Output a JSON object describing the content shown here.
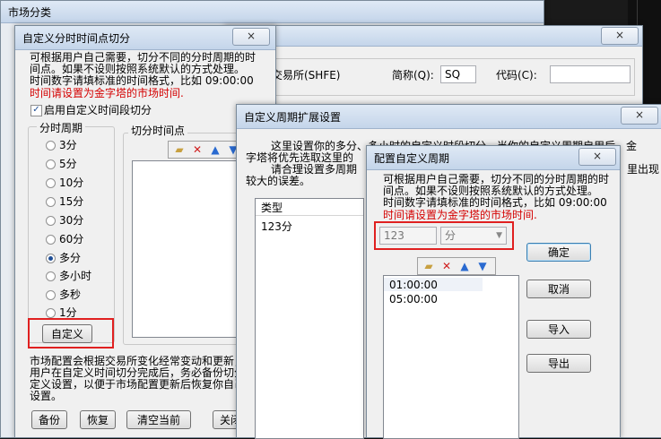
{
  "market_window": {
    "title": "市场分类"
  },
  "market_form": {
    "exchange_text": "交易所(SHFE)",
    "short_label": "简称(Q):",
    "short_value": "SQ",
    "code_label": "代码(C):",
    "code_value": ""
  },
  "split_dialog": {
    "title": "自定义分时时间点切分",
    "close": "×",
    "desc_lines": [
      "可根据用户自己需要，切分不同的分时周期的时",
      "间点。如果不设则按照系统默认的方式处理。",
      "时间数字请填标准的时间格式，比如 09:00:00"
    ],
    "warn": "时间请设置为金字塔的市场时间.",
    "enable_label": "启用自定义时间段切分",
    "enable_checked": "✓",
    "period_group": "分时周期",
    "periods": [
      "3分",
      "5分",
      "10分",
      "15分",
      "30分",
      "60分",
      "多分",
      "多小时",
      "多秒",
      "1分"
    ],
    "selected_period": "多分",
    "split_points_group": "切分时间点",
    "custom_button": "自定义",
    "note_lines": [
      "市场配置会根据交易所变化经常变动和更新，如",
      "用户在自定义时间切分完成后，务必备份切分",
      "定义设置，以便于市场配置更新后恢复你自己",
      "设置。"
    ],
    "backup_button": "备份",
    "restore_button": "恢复",
    "clear_button": "清空当前",
    "close_button": "关闭"
  },
  "ext_dialog": {
    "title": "自定义周期扩展设置",
    "close": "×",
    "desc_line1": "这里设置你的多分、多小时的自定义时段切分，当你的自定义周期启用后，金",
    "desc_line2": "字塔将优先选取这里的",
    "desc_line3": "请合理设置多周期",
    "desc_line4": "较大的误差。",
    "desc_right": "里出现",
    "type_header": "类型",
    "types": [
      "123分"
    ]
  },
  "config_dialog": {
    "title": "配置自定义周期",
    "close": "×",
    "desc_lines": [
      "可根据用户自己需要，切分不同的分时周期的时",
      "间点。如果不设则按照系统默认的方式处理。",
      "时间数字请填标准的时间格式，比如 09:00:00"
    ],
    "warn": "时间请设置为金字塔的市场时间.",
    "period_value": "123",
    "unit_value": "分",
    "times": [
      "01:00:00",
      "05:00:00"
    ],
    "ok_button": "确定",
    "cancel_button": "取消",
    "import_button": "导入",
    "export_button": "导出"
  },
  "colors": {
    "red": "#d40000",
    "highlight_box": "#e02020"
  }
}
